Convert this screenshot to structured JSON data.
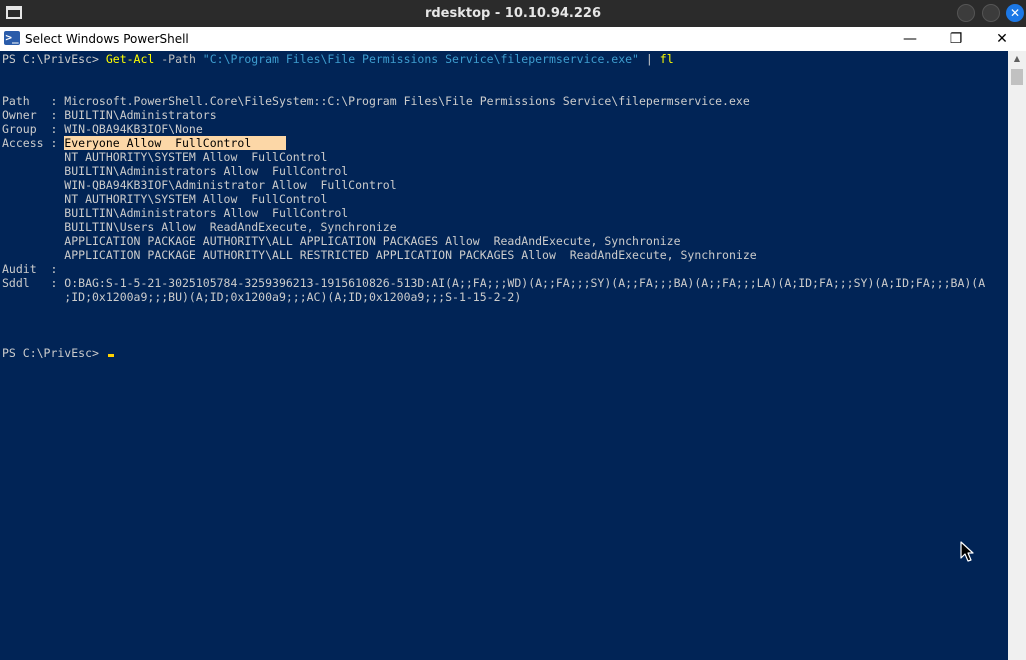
{
  "rdesktop": {
    "title": "rdesktop - 10.10.94.226",
    "close_glyph": "✕"
  },
  "window": {
    "title": "Select Windows PowerShell",
    "icon_glyph": ">_",
    "minimize_glyph": "—",
    "maximize_glyph": "❐",
    "close_glyph": "✕"
  },
  "console": {
    "prompt1": "PS C:\\PrivEsc> ",
    "cmd_name": "Get-Acl",
    "cmd_param": " -Path ",
    "cmd_path": "\"C:\\Program Files\\File Permissions Service\\filepermservice.exe\"",
    "cmd_pipe": " | ",
    "cmd_fl": "fl",
    "path_line": "Path   : Microsoft.PowerShell.Core\\FileSystem::C:\\Program Files\\File Permissions Service\\filepermservice.exe",
    "owner_line": "Owner  : BUILTIN\\Administrators",
    "group_line": "Group  : WIN-QBA94KB3IOF\\None",
    "access_label": "Access : ",
    "access_highlight": "Everyone Allow  FullControl     ",
    "access_lines": [
      "         NT AUTHORITY\\SYSTEM Allow  FullControl",
      "         BUILTIN\\Administrators Allow  FullControl",
      "         WIN-QBA94KB3IOF\\Administrator Allow  FullControl",
      "         NT AUTHORITY\\SYSTEM Allow  FullControl",
      "         BUILTIN\\Administrators Allow  FullControl",
      "         BUILTIN\\Users Allow  ReadAndExecute, Synchronize",
      "         APPLICATION PACKAGE AUTHORITY\\ALL APPLICATION PACKAGES Allow  ReadAndExecute, Synchronize",
      "         APPLICATION PACKAGE AUTHORITY\\ALL RESTRICTED APPLICATION PACKAGES Allow  ReadAndExecute, Synchronize"
    ],
    "audit_line": "Audit  :",
    "sddl_line1": "Sddl   : O:BAG:S-1-5-21-3025105784-3259396213-1915610826-513D:AI(A;;FA;;;WD)(A;;FA;;;SY)(A;;FA;;;BA)(A;;FA;;;LA)(A;ID;FA;;;SY)(A;ID;FA;;;BA)(A",
    "sddl_line2": "         ;ID;0x1200a9;;;BU)(A;ID;0x1200a9;;;AC)(A;ID;0x1200a9;;;S-1-15-2-2)",
    "prompt2": "PS C:\\PrivEsc> "
  },
  "scrollbar": {
    "up_glyph": "▲"
  },
  "colors": {
    "console_bg": "#012456",
    "console_fg": "#cccccc",
    "cmdlet": "#ffff00",
    "string": "#3e9dcf",
    "highlight": "#fcd7a7"
  }
}
